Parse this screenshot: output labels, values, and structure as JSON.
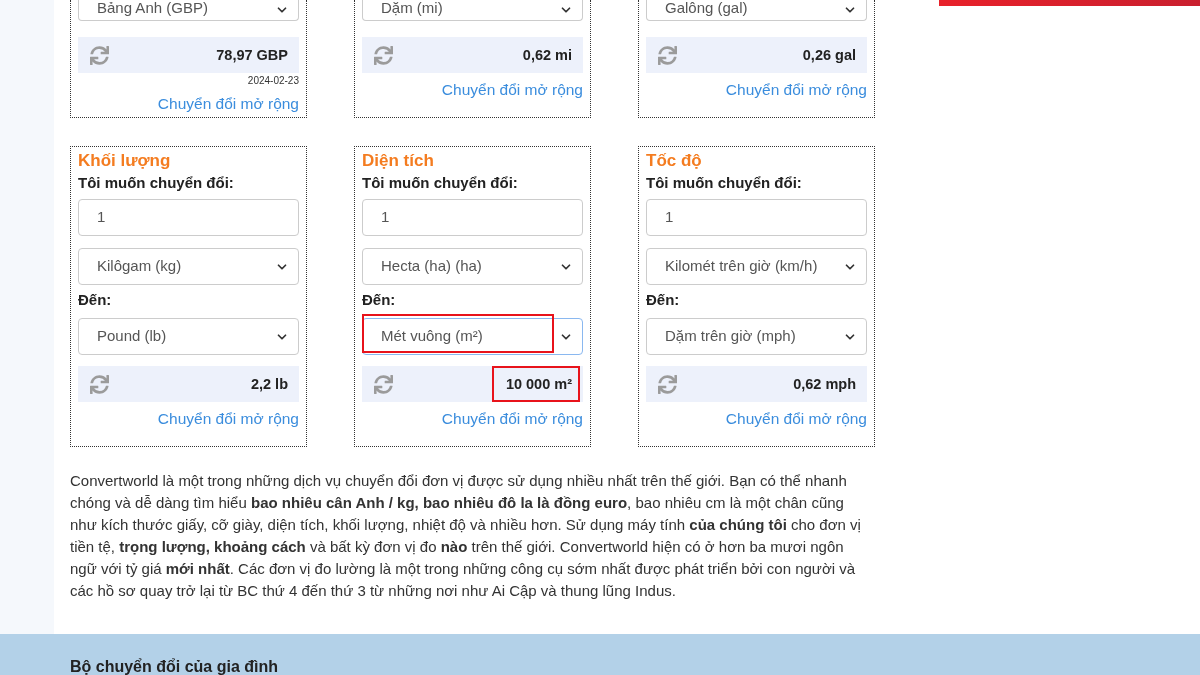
{
  "converters_top": [
    {
      "to_unit": "Bảng Anh (GBP)",
      "result": "78,97 GBP",
      "date": "2024-02-23",
      "link": "Chuyển đổi mở rộng"
    },
    {
      "to_unit": "Dặm (mi)",
      "result": "0,62 mi",
      "link": "Chuyển đổi mở rộng"
    },
    {
      "to_unit": "Galông (gal)",
      "result": "0,26 gal",
      "link": "Chuyển đổi mở rộng"
    }
  ],
  "converters": [
    {
      "title": "Khối lượng",
      "from_label": "Tôi muốn chuyển đổi:",
      "amount": "1",
      "from_unit": "Kilôgam (kg)",
      "to_label": "Đến:",
      "to_unit": "Pound (lb)",
      "to_unit_focused": false,
      "to_unit_highlighted": false,
      "result": "2,2 lb",
      "result_highlighted": false,
      "link": "Chuyển đổi mở rộng"
    },
    {
      "title": "Diện tích",
      "from_label": "Tôi muốn chuyển đổi:",
      "amount": "1",
      "from_unit": "Hecta (ha) (ha)",
      "to_label": "Đến:",
      "to_unit": "Mét vuông (m²)",
      "to_unit_focused": true,
      "to_unit_highlighted": true,
      "result": "10 000 m²",
      "result_highlighted": true,
      "link": "Chuyển đổi mở rộng"
    },
    {
      "title": "Tốc độ",
      "from_label": "Tôi muốn chuyển đổi:",
      "amount": "1",
      "from_unit": "Kilomét trên giờ (km/h)",
      "to_label": "Đến:",
      "to_unit": "Dặm trên giờ (mph)",
      "to_unit_focused": false,
      "to_unit_highlighted": false,
      "result": "0,62 mph",
      "result_highlighted": false,
      "link": "Chuyển đổi mở rộng"
    }
  ],
  "description": "Convertworld là một trong những dịch vụ chuyển đổi đơn vị được sử dụng nhiều nhất trên thế giới. Bạn có thể nhanh chóng và dễ dàng tìm hiểu **bao nhiêu cân Anh / kg, bao nhiêu đô la là đồng euro**, bao nhiêu cm là một chân cũng như kích thước giấy, cỡ giày, diện tích, khối lượng, nhiệt độ và nhiều hơn. Sử dụng máy tính **của chúng tôi** cho đơn vị tiền tệ, **trọng lượng, khoảng cách** và bất kỳ đơn vị đo **nào** trên thế giới. Convertworld hiện có ở hơn ba mươi ngôn ngữ với tỷ giá **mới nhất**. Các đơn vị đo lường là một trong những công cụ sớm nhất được phát triển bởi con người và các hồ sơ quay trở lại từ BC thứ 4 đến thứ 3 từ những nơi như Ai Cập và thung lũng Indus.",
  "footer": {
    "heading": "Bộ chuyển đổi của gia đình"
  }
}
